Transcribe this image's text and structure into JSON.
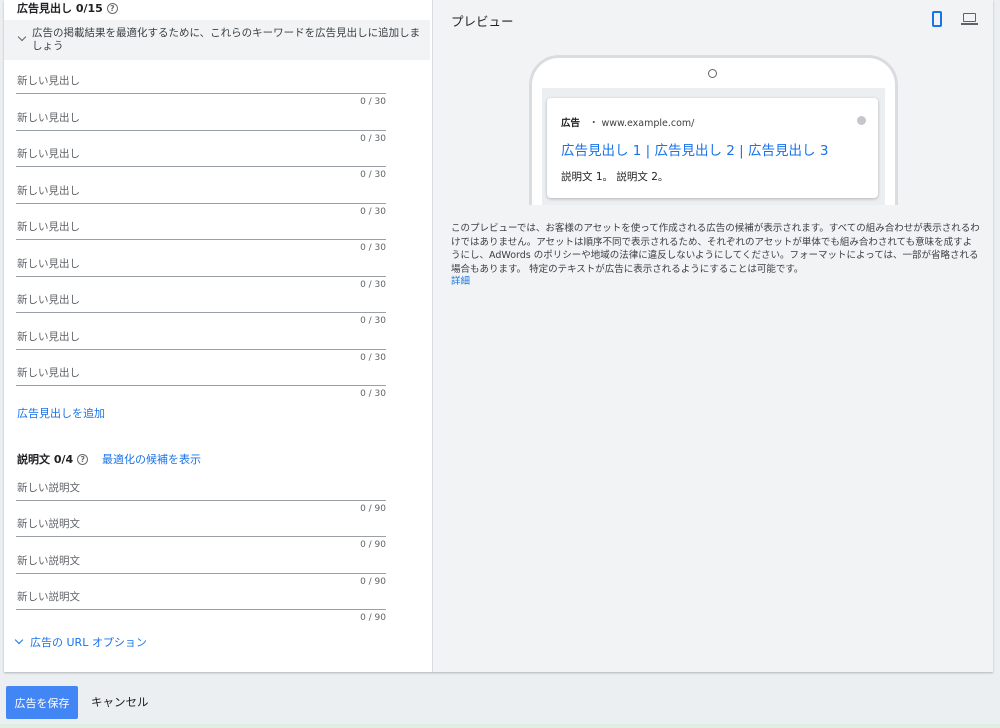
{
  "headlines": {
    "title": "広告見出し 0/15",
    "suggestion": "広告の掲載結果を最適化するために、これらのキーワードを広告見出しに追加しましょう",
    "placeholder": "新しい見出し",
    "count": "0 / 30",
    "add_link": "広告見出しを追加"
  },
  "descriptions": {
    "title": "説明文 0/4",
    "suggest_link": "最適化の候補を表示",
    "placeholder": "新しい説明文",
    "count": "0 / 90"
  },
  "url_options": {
    "label": "広告の URL オプション"
  },
  "preview": {
    "title": "プレビュー",
    "ad_label": "広告",
    "ad_url": "・ www.example.com/",
    "ad_headline": "広告見出し 1 | 広告見出し 2 | 広告見出し 3",
    "ad_description": "説明文 1。 説明文 2。",
    "note": "このプレビューでは、お客様のアセットを使って作成される広告の候補が表示されます。すべての組み合わせが表示されるわけではありません。アセットは順序不同で表示されるため、それぞれのアセットが単体でも組み合わされても意味を成すようにし、AdWords のポリシーや地域の法律に違反しないようにしてください。フォーマットによっては、一部が省略される場合もあります。 特定のテキストが広告に表示されるようにすることは可能です。",
    "note_link": "詳細"
  },
  "footer": {
    "save": "広告を保存",
    "cancel": "キャンセル"
  },
  "icons": {
    "help": "help-circle-icon",
    "chevron": "chevron-down-icon",
    "mobile": "mobile-device-icon",
    "desktop": "desktop-laptop-icon"
  },
  "colors": {
    "accent": "#1a73e8",
    "save_button": "#4285f4",
    "panel_bg": "#f1f3f4"
  }
}
